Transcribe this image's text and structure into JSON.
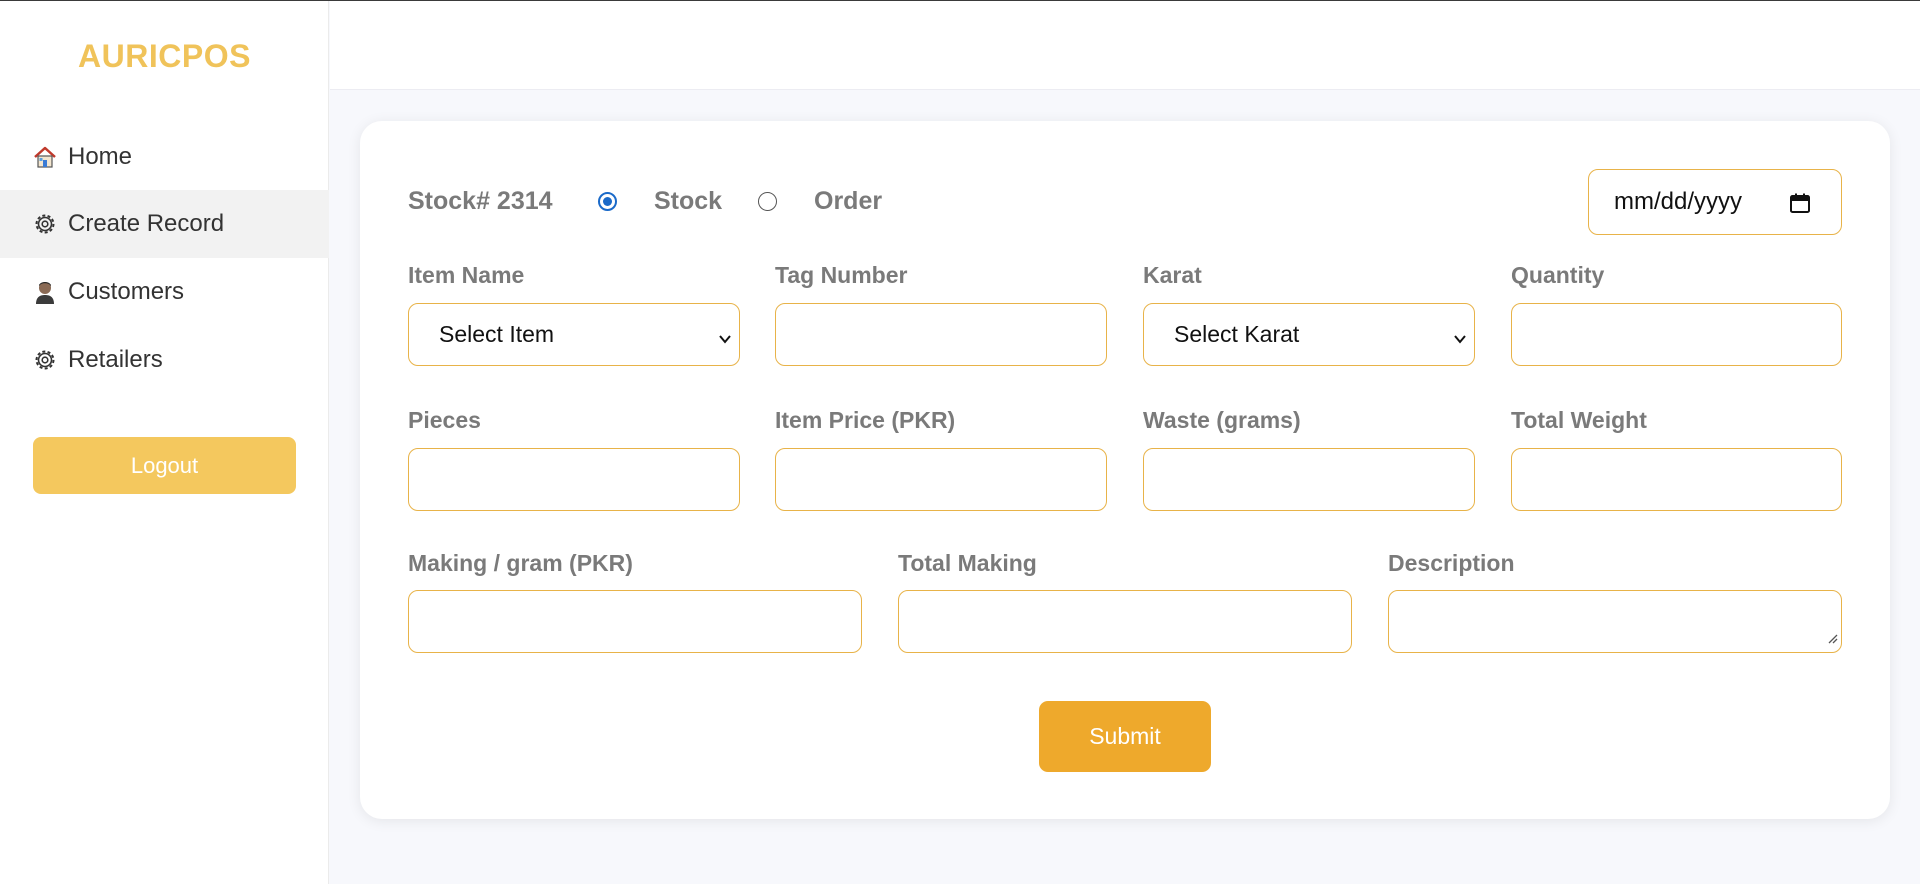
{
  "app": {
    "brand": "AURICPOS"
  },
  "sidebar": {
    "items": [
      {
        "label": "Home",
        "icon": "home-icon"
      },
      {
        "label": "Create Record",
        "icon": "gear-icon"
      },
      {
        "label": "Customers",
        "icon": "user-icon"
      },
      {
        "label": "Retailers",
        "icon": "gear-icon"
      }
    ],
    "logout_label": "Logout"
  },
  "form": {
    "stock_number": "Stock# 2314",
    "type_options": [
      "Stock",
      "Order"
    ],
    "selected_type": "Stock",
    "date_placeholder": "mm/dd/yyyy",
    "fields": {
      "item_name": {
        "label": "Item Name",
        "value": "Select Item"
      },
      "tag_number": {
        "label": "Tag Number",
        "value": ""
      },
      "karat": {
        "label": "Karat",
        "value": "Select Karat"
      },
      "quantity": {
        "label": "Quantity",
        "value": ""
      },
      "pieces": {
        "label": "Pieces",
        "value": ""
      },
      "item_price": {
        "label": "Item Price (PKR)",
        "value": ""
      },
      "waste": {
        "label": "Waste (grams)",
        "value": ""
      },
      "total_weight": {
        "label": "Total Weight",
        "value": ""
      },
      "making_per_gram": {
        "label": "Making / gram (PKR)",
        "value": ""
      },
      "total_making": {
        "label": "Total Making",
        "value": ""
      },
      "description": {
        "label": "Description",
        "value": ""
      }
    },
    "submit_label": "Submit"
  },
  "colors": {
    "brand": "#f0c35a",
    "accent": "#eea92c",
    "field_border": "#e8b349",
    "radio_checked": "#1b6ac9"
  }
}
